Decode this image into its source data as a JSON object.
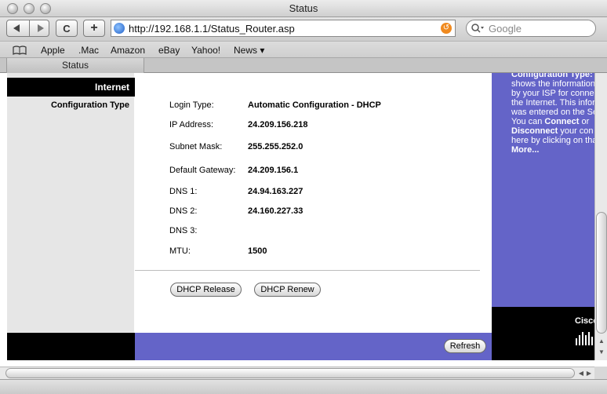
{
  "window": {
    "title": "Status"
  },
  "toolbar": {
    "back_icon": "back-arrow-icon",
    "forward_icon": "forward-arrow-icon",
    "reload_glyph": "C",
    "add_glyph": "+",
    "url": "http://192.168.1.1/Status_Router.asp",
    "search_placeholder": "Google"
  },
  "bookmarks": {
    "items": [
      "Apple",
      ".Mac",
      "Amazon",
      "eBay",
      "Yahoo!",
      "News ▾"
    ]
  },
  "tabs": {
    "active": "Status"
  },
  "page": {
    "section_title": "Internet",
    "subsection_title": "Configuration Type",
    "fields": [
      {
        "label": "Login Type:",
        "value": "Automatic Configuration - DHCP"
      },
      {
        "label": "IP Address:",
        "value": "24.209.156.218"
      },
      {
        "label": "Subnet Mask:",
        "value": "255.255.252.0"
      },
      {
        "label": "Default Gateway:",
        "value": "24.209.156.1"
      },
      {
        "label": "DNS 1:",
        "value": "24.94.163.227"
      },
      {
        "label": "DNS 2:",
        "value": "24.160.227.33"
      },
      {
        "label": "DNS 3:",
        "value": ""
      },
      {
        "label": "MTU:",
        "value": "1500"
      }
    ],
    "buttons": {
      "dhcp_release": "DHCP Release",
      "dhcp_renew": "DHCP Renew",
      "refresh": "Refresh"
    }
  },
  "help": {
    "line1": "Configuration Type:",
    "line2": "shows the information",
    "line3": "by your ISP for conne",
    "line4": "the Internet. This infor",
    "line5": "was entered on the Se",
    "line6_pre": "You can ",
    "line6_bold": "Connect",
    "line6_post": " or",
    "line7_bold": "Disconnect",
    "line7_post": " your con",
    "line8": "here by clicking on tha",
    "more": "More..."
  },
  "brand": {
    "name": "Cisco",
    "color": "#6464c8"
  }
}
